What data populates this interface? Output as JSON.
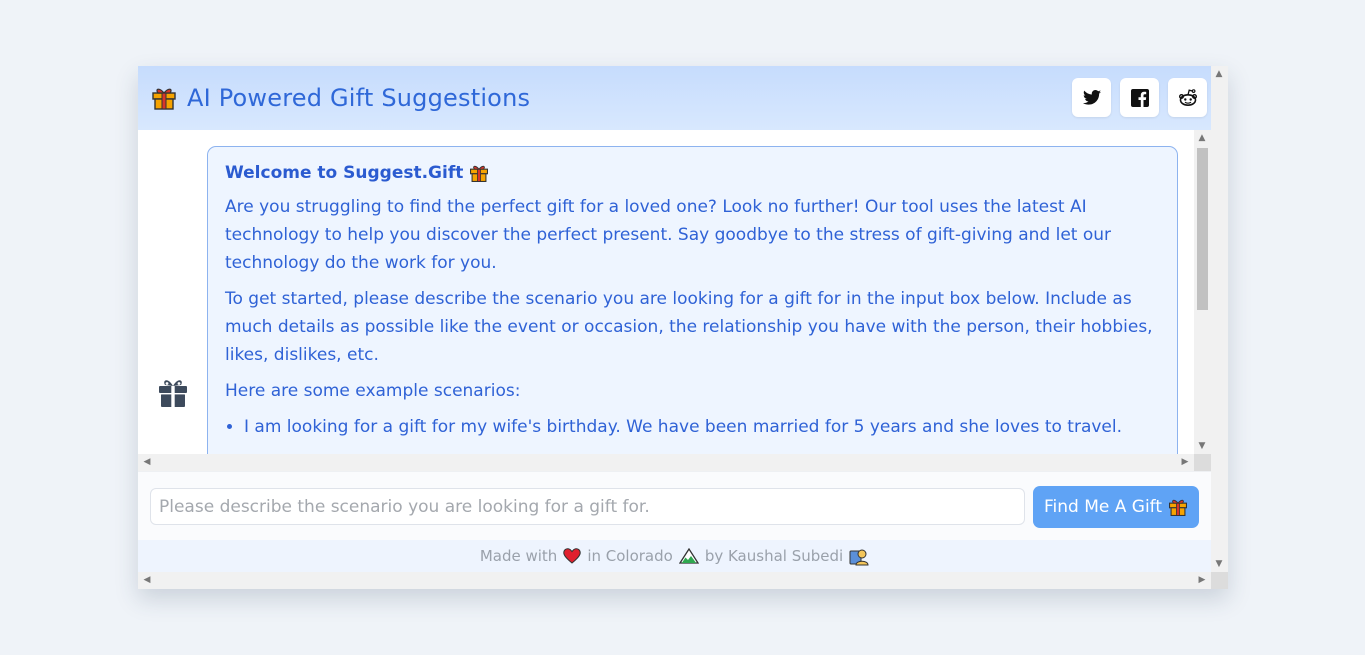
{
  "header": {
    "title": "AI Powered Gift Suggestions",
    "share_buttons": [
      {
        "icon": "twitter-icon"
      },
      {
        "icon": "facebook-icon"
      },
      {
        "icon": "reddit-icon"
      }
    ]
  },
  "chat": {
    "welcome_title": "Welcome to Suggest.Gift",
    "paragraphs": [
      "Are you struggling to find the perfect gift for a loved one? Look no further! Our tool uses the latest AI technology to help you discover the perfect present. Say goodbye to the stress of gift-giving and let our technology do the work for you.",
      "To get started, please describe the scenario you are looking for a gift for in the input box below. Include as much details as possible like the event or occasion, the relationship you have with the person, their hobbies, likes, dislikes, etc.",
      "Here are some example scenarios:"
    ],
    "examples": [
      "I am looking for a gift for my wife's birthday. We have been married for 5 years and she loves to travel."
    ]
  },
  "input": {
    "placeholder": "Please describe the scenario you are looking for a gift for.",
    "button_label": "Find Me A Gift"
  },
  "footer": {
    "made_with": "Made with",
    "in_place": "in Colorado",
    "by_author": "by Kaushal Subedi"
  },
  "colors": {
    "accent": "#5fa3f5",
    "title": "#2f68d8",
    "header_bg": "#c6dcfd",
    "bubble_bg": "#eef5ff"
  }
}
